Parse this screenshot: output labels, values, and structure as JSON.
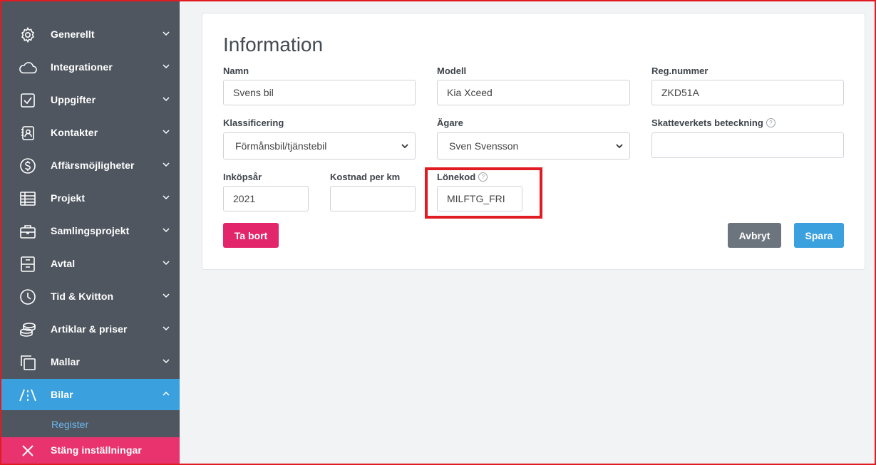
{
  "sidebar": {
    "items": [
      {
        "label": "Generellt",
        "icon": "gear-icon"
      },
      {
        "label": "Integrationer",
        "icon": "cloud-icon"
      },
      {
        "label": "Uppgifter",
        "icon": "checkbox-icon"
      },
      {
        "label": "Kontakter",
        "icon": "contact-card-icon"
      },
      {
        "label": "Affärsmöjligheter",
        "icon": "dollar-icon"
      },
      {
        "label": "Projekt",
        "icon": "table-icon"
      },
      {
        "label": "Samlingsprojekt",
        "icon": "briefcase-icon"
      },
      {
        "label": "Avtal",
        "icon": "cabinet-icon"
      },
      {
        "label": "Tid & Kvitton",
        "icon": "clock-icon"
      },
      {
        "label": "Artiklar & priser",
        "icon": "coins-icon"
      },
      {
        "label": "Mallar",
        "icon": "copy-icon"
      },
      {
        "label": "Bilar",
        "icon": "road-icon"
      }
    ],
    "active_item": "Bilar",
    "sub_item": "Register",
    "close_label": "Stäng inställningar"
  },
  "form": {
    "title": "Information",
    "name_label": "Namn",
    "name_value": "Svens bil",
    "model_label": "Modell",
    "model_value": "Kia Xceed",
    "reg_label": "Reg.nummer",
    "reg_value": "ZKD51A",
    "class_label": "Klassificering",
    "class_value": "Förmånsbil/tjänstebil",
    "owner_label": "Ägare",
    "owner_value": "Sven Svensson",
    "tax_label": "Skatteverkets beteckning",
    "tax_value": "",
    "year_label": "Inköpsår",
    "year_value": "2021",
    "cost_label": "Kostnad per km",
    "cost_value": "",
    "salary_label": "Lönekod",
    "salary_value": "MILFTG_FRI",
    "help_glyph": "?"
  },
  "buttons": {
    "delete_label": "Ta bort",
    "cancel_label": "Avbryt",
    "save_label": "Spara"
  },
  "colors": {
    "sidebar_bg": "#4f565f",
    "active_bg": "#3aa0de",
    "close_bg": "#e8336f",
    "delete_bg": "#e3266b",
    "cancel_bg": "#6c757d",
    "save_bg": "#3aa0de",
    "highlight": "#e01b22"
  }
}
